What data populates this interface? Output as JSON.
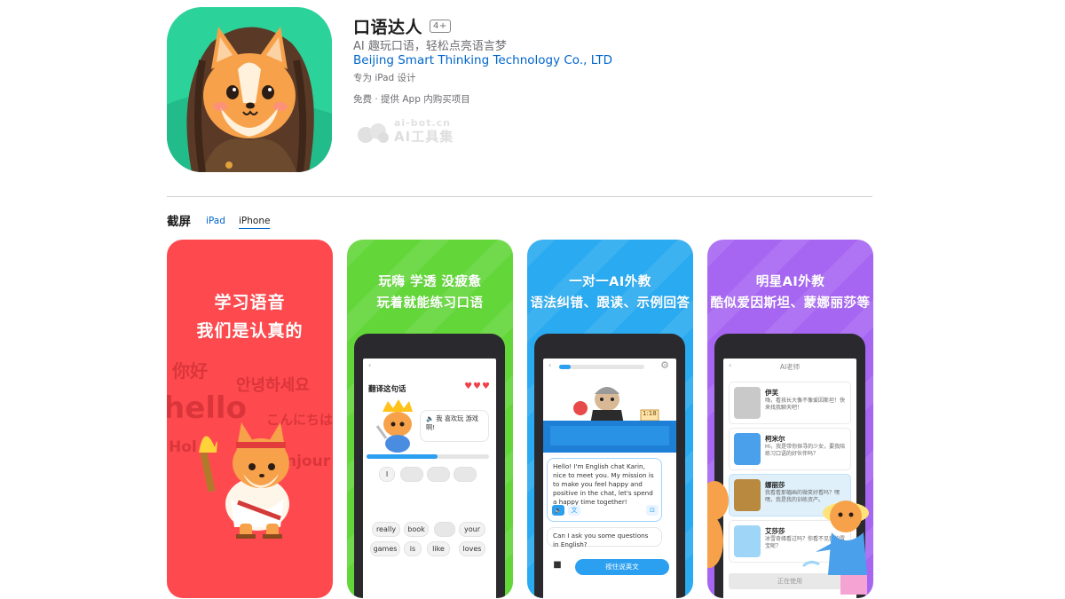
{
  "app": {
    "title": "口语达人",
    "age_rating": "4+",
    "subtitle": "AI 趣玩口语，轻松点亮语言梦",
    "developer": "Beijing Smart Thinking Technology Co., LTD",
    "designed_for": "专为 iPad 设计",
    "price_line": "免费 · 提供 App 内购买项目"
  },
  "watermark": {
    "line1": "ai-bot.cn",
    "line2": "AI工具集"
  },
  "screenshots": {
    "title": "截屏",
    "tabs": [
      {
        "label": "iPad",
        "selected": false
      },
      {
        "label": "iPhone",
        "selected": true
      }
    ],
    "cards": [
      {
        "bg_color": "#fe4a4e",
        "headline": [
          "学习语音",
          "我们是认真的"
        ],
        "bg_words": [
          "你好",
          "안녕하세요",
          "hello",
          "こんにちは",
          "Hol",
          "njour"
        ]
      },
      {
        "bg_color": "#63d63a",
        "headline": [
          "玩嗨 学透 没疲惫",
          "玩着就能练习口语"
        ],
        "screen": {
          "prompt": "翻译这句话",
          "speech": "我 喜欢玩 游戏啊!",
          "answer_chips": [
            "I",
            "",
            "",
            ""
          ],
          "word_bank": [
            "really",
            "book",
            "",
            "your",
            "games",
            "is",
            "like",
            "loves"
          ]
        }
      },
      {
        "bg_color": "#2aaaf0",
        "headline": [
          "一对一AI外教",
          "语法纠错、跟读、示例回答"
        ],
        "screen": {
          "timer": "1:18",
          "bot_message": "Hello! I'm English chat Karin, nice to meet you. My mission is to make you feel happy and positive in the chat, let's spend a happy time together!",
          "user_message": "Can I ask you some questions in English?",
          "hold_button": "按住说英文"
        }
      },
      {
        "bg_color": "#a766f2",
        "headline": [
          "明星AI外教",
          "酷似爱因斯坦、蒙娜丽莎等"
        ],
        "screen": {
          "title": "AI老师",
          "teachers": [
            {
              "name": "伊芙",
              "desc": "嗨，看孩长大像不像爱因斯坦！快来找我聊天吧！"
            },
            {
              "name": "柯米尔",
              "desc": "Hi，我是带你探寻的少女，要我陪练习口语的好伙伴吗？"
            },
            {
              "name": "娜丽莎",
              "desc": "我看看那幅画的微笑好看吗？嘿嘿，我是我的训练资产。"
            },
            {
              "name": "艾莎莎",
              "desc": "冰雪奇缘看过吗？你看不见我的雪宝呢？"
            }
          ],
          "status_button": "正在使用"
        }
      }
    ]
  }
}
